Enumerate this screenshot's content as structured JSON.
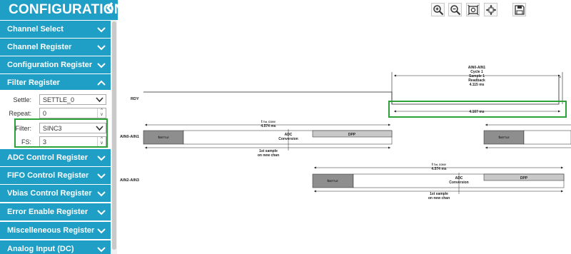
{
  "sidebar": {
    "title": "CONFIGURATION",
    "collapse_icon": "chevron-left-icon",
    "items": [
      {
        "label": "Channel Select",
        "expanded": false
      },
      {
        "label": "Channel Register",
        "expanded": false
      },
      {
        "label": "Configuration Register",
        "expanded": false
      },
      {
        "label": "Filter Register",
        "expanded": true
      },
      {
        "label": "ADC Control Register",
        "expanded": false
      },
      {
        "label": "FIFO Control Register",
        "expanded": false
      },
      {
        "label": "Vbias Control Register",
        "expanded": false
      },
      {
        "label": "Error Enable Register",
        "expanded": false
      },
      {
        "label": "Miscelleneous Register",
        "expanded": false
      },
      {
        "label": "Analog Input (DC)",
        "expanded": false
      }
    ],
    "filter_fields": {
      "settle_label": "Settle:",
      "settle_value": "SETTLE_0",
      "repeat_label": "Repeat:",
      "repeat_value": "0",
      "filter_label": "Filter:",
      "filter_value": "SINC3",
      "fs_label": "FS:",
      "fs_value": "3"
    },
    "colors": {
      "accent": "#1f9ec6",
      "highlight": "#2da23a"
    }
  },
  "toolbar": {
    "buttons": [
      {
        "icon": "zoom-in-icon"
      },
      {
        "icon": "zoom-out-icon"
      },
      {
        "icon": "fit-to-window-icon"
      },
      {
        "icon": "pan-icon"
      },
      {
        "icon": "save-icon"
      }
    ]
  },
  "diagram": {
    "rdy_label": "RDY",
    "row1_label": "AIN0-AIN1",
    "row2_label": "AIN2-AIN3",
    "readback_lines": [
      "AIN0-AIN1",
      "Cycle 1",
      "Sample 1",
      "Readback",
      "4.115 ms"
    ],
    "period_label": "4.167 ms",
    "conv_time_label": "t",
    "conv_time_sub": "Tot_CONV",
    "conv_time_value": "4.574 ms",
    "settle_box_label": "t",
    "settle_box_sub": "SETTLE",
    "adc_conversion_lines": [
      "ADC",
      "Conversion"
    ],
    "dpp_label": "DPP",
    "first_sample_lines": [
      "1st sample",
      "on new chan"
    ]
  }
}
